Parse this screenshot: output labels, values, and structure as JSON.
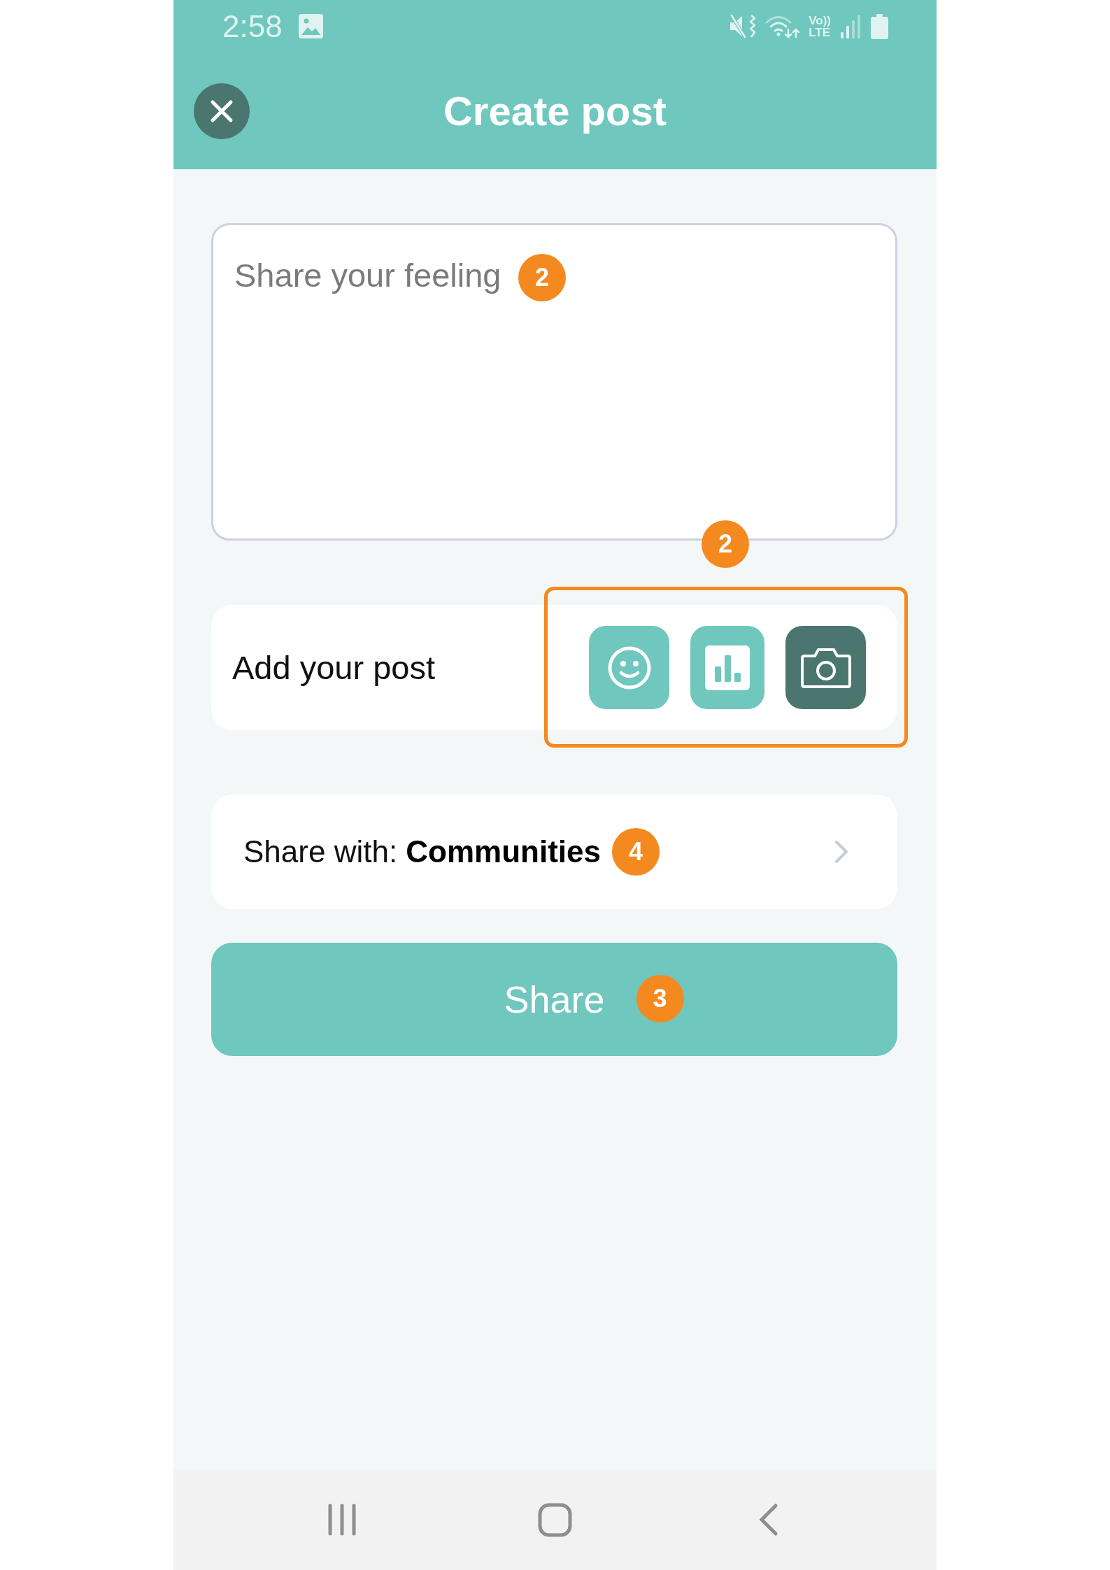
{
  "status_bar": {
    "time": "2:58",
    "network": [
      "Vo))",
      "LTE"
    ]
  },
  "header": {
    "title": "Create post"
  },
  "post_field": {
    "placeholder": "Share your feeling",
    "badge": "2"
  },
  "add_post": {
    "label": "Add your post",
    "highlighted": true,
    "highlight_badge": "2",
    "tools": [
      {
        "kind": "emoji",
        "selected": false
      },
      {
        "kind": "chart",
        "selected": false
      },
      {
        "kind": "camera",
        "selected": true
      }
    ]
  },
  "share_with": {
    "label": "Share with: **Communities**",
    "badge": "4"
  },
  "share_button": {
    "label": "Share",
    "badge": "3"
  }
}
